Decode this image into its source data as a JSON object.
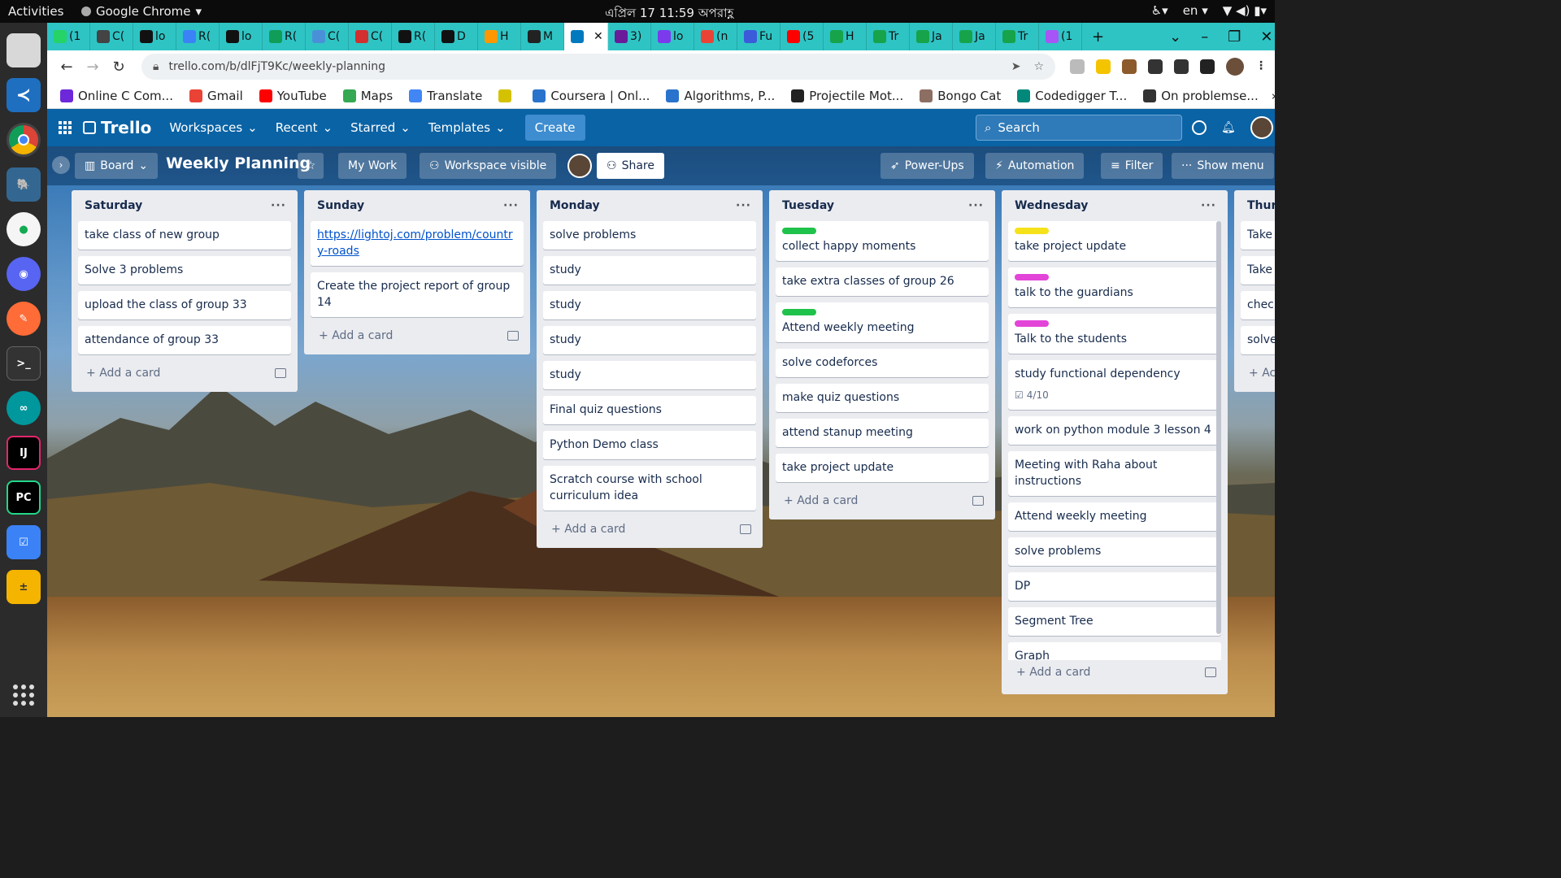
{
  "system": {
    "activities": "Activities",
    "app": "Google Chrome",
    "clock": "এপ্রিল 17  11:59 অপরাহ্ণ",
    "lang": "en"
  },
  "tabs": [
    {
      "label": "(1",
      "color": "#25d366"
    },
    {
      "label": "C(",
      "color": "#444444"
    },
    {
      "label": "lo",
      "color": "#111111"
    },
    {
      "label": "R(",
      "color": "#3b82f6"
    },
    {
      "label": "lo",
      "color": "#111111"
    },
    {
      "label": "R(",
      "color": "#0f9d58"
    },
    {
      "label": "C(",
      "color": "#4a90d9"
    },
    {
      "label": "C(",
      "color": "#d32f2f"
    },
    {
      "label": "R(",
      "color": "#111111"
    },
    {
      "label": "D",
      "color": "#111111"
    },
    {
      "label": "H",
      "color": "#ff9800"
    },
    {
      "label": "M",
      "color": "#222222"
    },
    {
      "label": "",
      "color": "#0079bf"
    },
    {
      "label": "3)",
      "color": "#6a1b9a"
    },
    {
      "label": "lo",
      "color": "#7c3aed"
    },
    {
      "label": "(n",
      "color": "#ea4335"
    },
    {
      "label": "Fu",
      "color": "#3b5bdb"
    },
    {
      "label": "(5",
      "color": "#ff0000"
    },
    {
      "label": "H",
      "color": "#16a34a"
    },
    {
      "label": "Tr",
      "color": "#16a34a"
    },
    {
      "label": "Ja",
      "color": "#16a34a"
    },
    {
      "label": "Ja",
      "color": "#16a34a"
    },
    {
      "label": "Tr",
      "color": "#16a34a"
    },
    {
      "label": "(1",
      "color": "#a855f7"
    }
  ],
  "url": "trello.com/b/dlFjT9Kc/weekly-planning",
  "bookmarks": [
    {
      "label": "Online C Com...",
      "color": "#6d28d9"
    },
    {
      "label": "Gmail",
      "color": "#ea4335"
    },
    {
      "label": "YouTube",
      "color": "#ff0000"
    },
    {
      "label": "Maps",
      "color": "#34a853"
    },
    {
      "label": "Translate",
      "color": "#4285f4"
    },
    {
      "label": "",
      "color": "#d4c200"
    },
    {
      "label": "Coursera | Onl...",
      "color": "#2a73cc"
    },
    {
      "label": "Algorithms, P...",
      "color": "#2a73cc"
    },
    {
      "label": "Projectile Mot...",
      "color": "#222222"
    },
    {
      "label": "Bongo Cat",
      "color": "#8d6e63"
    },
    {
      "label": "Codedigger T...",
      "color": "#00897b"
    },
    {
      "label": "On problemse...",
      "color": "#333333"
    }
  ],
  "bookmarks_more": "»",
  "nav": {
    "logo": "Trello",
    "workspaces": "Workspaces",
    "recent": "Recent",
    "starred": "Starred",
    "templates": "Templates",
    "create": "Create",
    "search": "Search"
  },
  "board": {
    "view": "Board",
    "title": "Weekly Planning",
    "my_work": "My Work",
    "visibility": "Workspace visible",
    "share": "Share",
    "power_ups": "Power-Ups",
    "automation": "Automation",
    "filter": "Filter",
    "show_menu": "Show menu",
    "add_card": "Add a card"
  },
  "lists": [
    {
      "name": "Saturday",
      "cards": [
        {
          "title": "take class of new group"
        },
        {
          "title": "Solve 3 problems"
        },
        {
          "title": "upload the class of group 33"
        },
        {
          "title": "attendance of group 33"
        }
      ]
    },
    {
      "name": "Sunday",
      "cards": [
        {
          "title": "https://lightoj.com/problem/country-roads",
          "link": true
        },
        {
          "title": "Create the project report of group 14"
        }
      ]
    },
    {
      "name": "Monday",
      "cards": [
        {
          "title": "solve problems"
        },
        {
          "title": "study"
        },
        {
          "title": "study"
        },
        {
          "title": "study"
        },
        {
          "title": "study"
        },
        {
          "title": "Final quiz questions"
        },
        {
          "title": "Python Demo class"
        },
        {
          "title": "Scratch course with school curriculum idea"
        }
      ]
    },
    {
      "name": "Tuesday",
      "cards": [
        {
          "title": "collect happy moments",
          "label": "#1fc24a"
        },
        {
          "title": "take extra classes of group 26"
        },
        {
          "title": "Attend weekly meeting",
          "label": "#1fc24a"
        },
        {
          "title": "solve codeforces"
        },
        {
          "title": "make quiz questions"
        },
        {
          "title": "attend stanup meeting"
        },
        {
          "title": "take project update"
        }
      ]
    },
    {
      "name": "Wednesday",
      "cards": [
        {
          "title": "take project update",
          "label": "#f5e21b"
        },
        {
          "title": "talk to the guardians",
          "label": "#e345d9"
        },
        {
          "title": "Talk to the students",
          "label": "#e345d9"
        },
        {
          "title": "study functional dependency",
          "badge": "4/10"
        },
        {
          "title": "work on python module 3 lesson 4"
        },
        {
          "title": "Meeting with Raha about instructions"
        },
        {
          "title": "Attend weekly meeting"
        },
        {
          "title": "solve problems"
        },
        {
          "title": "DP"
        },
        {
          "title": "Segment Tree"
        },
        {
          "title": "Graph"
        }
      ]
    },
    {
      "name": "Thurs",
      "cards": [
        {
          "title": "Take p"
        },
        {
          "title": "Take s"
        },
        {
          "title": "check"
        },
        {
          "title": "solve"
        }
      ],
      "add_card": "Ac"
    }
  ]
}
